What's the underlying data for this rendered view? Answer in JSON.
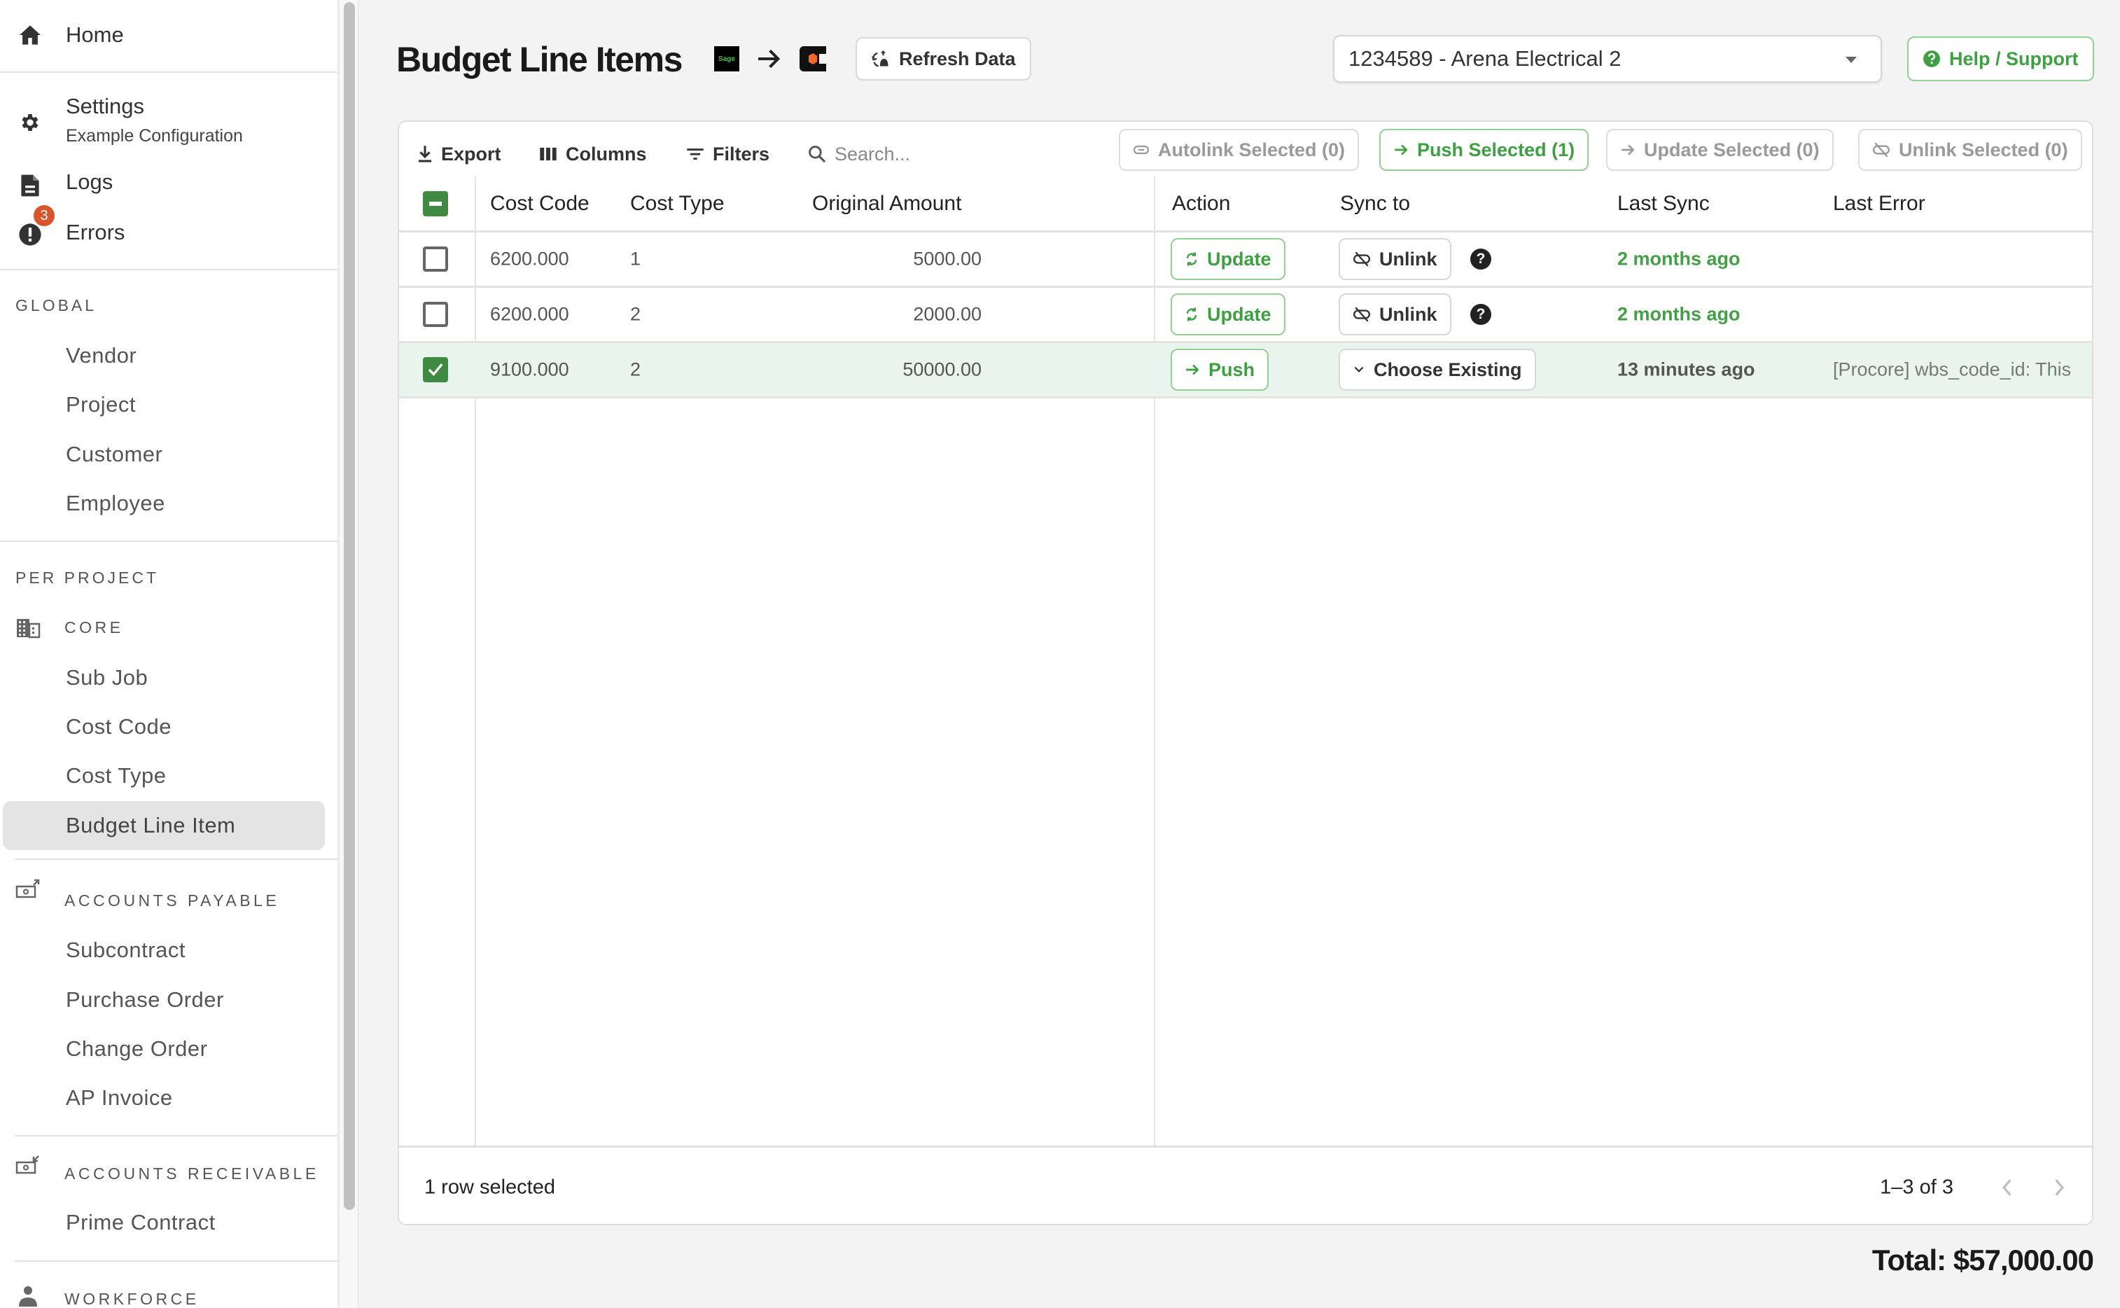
{
  "sidebar": {
    "home": "Home",
    "settings": "Settings",
    "settings_sub": "Example Configuration",
    "logs": "Logs",
    "errors": "Errors",
    "errors_badge": "3",
    "global_heading": "GLOBAL",
    "global_items": [
      "Vendor",
      "Project",
      "Customer",
      "Employee"
    ],
    "per_project_heading": "PER PROJECT",
    "groups": {
      "core": {
        "label": "CORE",
        "items": [
          "Sub Job",
          "Cost Code",
          "Cost Type",
          "Budget Line Item"
        ]
      },
      "ap": {
        "label": "ACCOUNTS PAYABLE",
        "items": [
          "Subcontract",
          "Purchase Order",
          "Change Order",
          "AP Invoice"
        ]
      },
      "ar": {
        "label": "ACCOUNTS RECEIVABLE",
        "items": [
          "Prime Contract"
        ]
      },
      "workforce": {
        "label": "WORKFORCE"
      }
    },
    "active_item": "Budget Line Item"
  },
  "header": {
    "title": "Budget Line Items",
    "source_logo": "Sage",
    "refresh_label": "Refresh Data",
    "project_select_value": "1234589 - Arena Electrical 2",
    "help_label": "Help / Support"
  },
  "toolbar": {
    "export": "Export",
    "columns": "Columns",
    "filters": "Filters",
    "search_placeholder": "Search...",
    "autolink": "Autolink Selected (0)",
    "push": "Push Selected (1)",
    "update": "Update Selected (0)",
    "unlink": "Unlink Selected (0)"
  },
  "table": {
    "columns": [
      "Cost Code",
      "Cost Type",
      "Original Amount",
      "Action",
      "Sync to",
      "Last Sync",
      "Last Error"
    ],
    "rows": [
      {
        "selected": false,
        "cost_code": "6200.000",
        "cost_type": "1",
        "amount": "5000.00",
        "action": "Update",
        "sync_to": "Unlink",
        "last_sync": "2 months ago",
        "last_error": ""
      },
      {
        "selected": false,
        "cost_code": "6200.000",
        "cost_type": "2",
        "amount": "2000.00",
        "action": "Update",
        "sync_to": "Unlink",
        "last_sync": "2 months ago",
        "last_error": ""
      },
      {
        "selected": true,
        "cost_code": "9100.000",
        "cost_type": "2",
        "amount": "50000.00",
        "action": "Push",
        "sync_to": "Choose Existing",
        "last_sync": "13 minutes ago",
        "last_error": "[Procore] wbs_code_id: This"
      }
    ]
  },
  "footer": {
    "selection": "1 row selected",
    "pagination": "1–3 of 3"
  },
  "total": "Total: $57,000.00",
  "colors": {
    "accent_green": "#3f9f43",
    "checkbox_green": "#3f8a43",
    "badge_red": "#d9542b",
    "selected_row": "#e9f4ee"
  }
}
